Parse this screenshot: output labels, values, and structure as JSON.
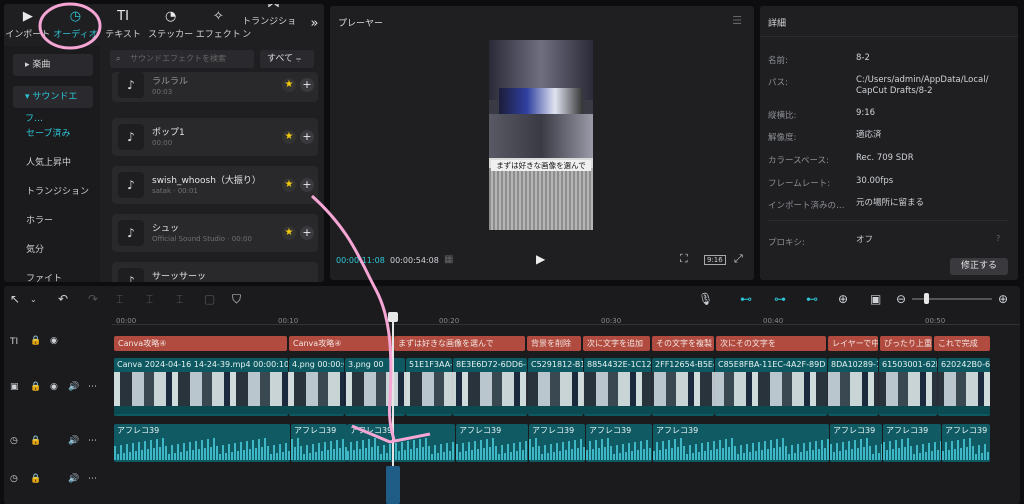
{
  "media_tabs": [
    {
      "label": "インポート",
      "icon": "import-icon"
    },
    {
      "label": "オーディオ",
      "icon": "audio-icon",
      "active": true
    },
    {
      "label": "テキスト",
      "icon": "text-icon"
    },
    {
      "label": "ステッカー",
      "icon": "sticker-icon"
    },
    {
      "label": "エフェクト",
      "icon": "effect-icon"
    },
    {
      "label": "トランジション",
      "icon": "transition-icon"
    }
  ],
  "left_nav": {
    "music": "楽曲",
    "sfx": "サウンドエフ…",
    "subs": [
      "セーブ済み",
      "人気上昇中",
      "トランジション",
      "ホラー",
      "気分",
      "ファイト"
    ]
  },
  "search": {
    "placeholder": "サウンドエフェクトを検索",
    "all_label": "すべて"
  },
  "sounds": [
    {
      "title": "ラルラル",
      "sub": "00:03"
    },
    {
      "title": "ポップ1",
      "sub": "00:00"
    },
    {
      "title": "swish_whoosh（大振り）",
      "sub": "satak · 00:01"
    },
    {
      "title": "シュッ",
      "sub": "Official Sound Studio · 00:00"
    },
    {
      "title": "サーッサーッ",
      "sub": ""
    }
  ],
  "player": {
    "title": "プレーヤー",
    "current_time": "00:00:11:08",
    "total_time": "00:00:54:08",
    "subtitle": "まずは好きな画像を選んで",
    "ratio_badge": "9:16"
  },
  "detail": {
    "title": "詳細",
    "rows": [
      {
        "label": "名前:",
        "value": "8-2"
      },
      {
        "label": "パス:",
        "value": "C:/Users/admin/AppData/Local/",
        "value2": "CapCut Drafts/8-2"
      },
      {
        "label": "縦横比:",
        "value": "9:16"
      },
      {
        "label": "解像度:",
        "value": "適応済"
      },
      {
        "label": "カラースペース:",
        "value": "Rec. 709 SDR"
      },
      {
        "label": "フレームレート:",
        "value": "30.00fps"
      },
      {
        "label": "インポート済みの…",
        "value": "元の場所に留まる"
      }
    ],
    "proxy_label": "プロキシ:",
    "proxy_value": "オフ",
    "edit_button": "修正する"
  },
  "ruler": [
    "00:00",
    "00:10",
    "00:20",
    "00:30",
    "00:40",
    "00:50"
  ],
  "text_clips": [
    "Canva攻略④",
    "Canva攻略④",
    "まずは好きな画像を選んで",
    "背景を削除",
    "次に文字を追加",
    "その文字を複製",
    "次にその文字を",
    "レイヤーで中",
    "ぴったり上重ねて",
    "これで完成"
  ],
  "video_clips": [
    "Canva 2024-04-16 14-24-39.mp4  00:00:10:25",
    "4.png  00:00:0",
    "3.png  00",
    "51E1F3AA-",
    "8E3E6D72-6DD6-",
    "C5291812-B1",
    "8854432E-1C12-",
    "2FF12654-B5E4",
    "C85E8FBA-11EC-4A2F-89D",
    "8DA10289-1",
    "61503001-62E",
    "620242B0-61"
  ],
  "audio_label": "アフレコ39",
  "colors": {
    "accent": "#2ec6d6",
    "text_clip": "#b14b3f",
    "video_clip": "#0e5961",
    "audio_clip": "#0f5a63"
  }
}
